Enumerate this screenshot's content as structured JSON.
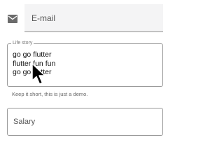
{
  "email": {
    "placeholder": "E-mail",
    "icon": "email-icon"
  },
  "life_story": {
    "label": "Life story",
    "lines": [
      "go go flutter",
      "flutter fun fun",
      "go go flutter"
    ],
    "helper": "Keep it short, this is just a demo."
  },
  "salary": {
    "placeholder": "Salary"
  },
  "colors": {
    "field_fill": "#f4f4f5",
    "outline": "#9a9a9a",
    "icon": "#6b6b6b"
  }
}
